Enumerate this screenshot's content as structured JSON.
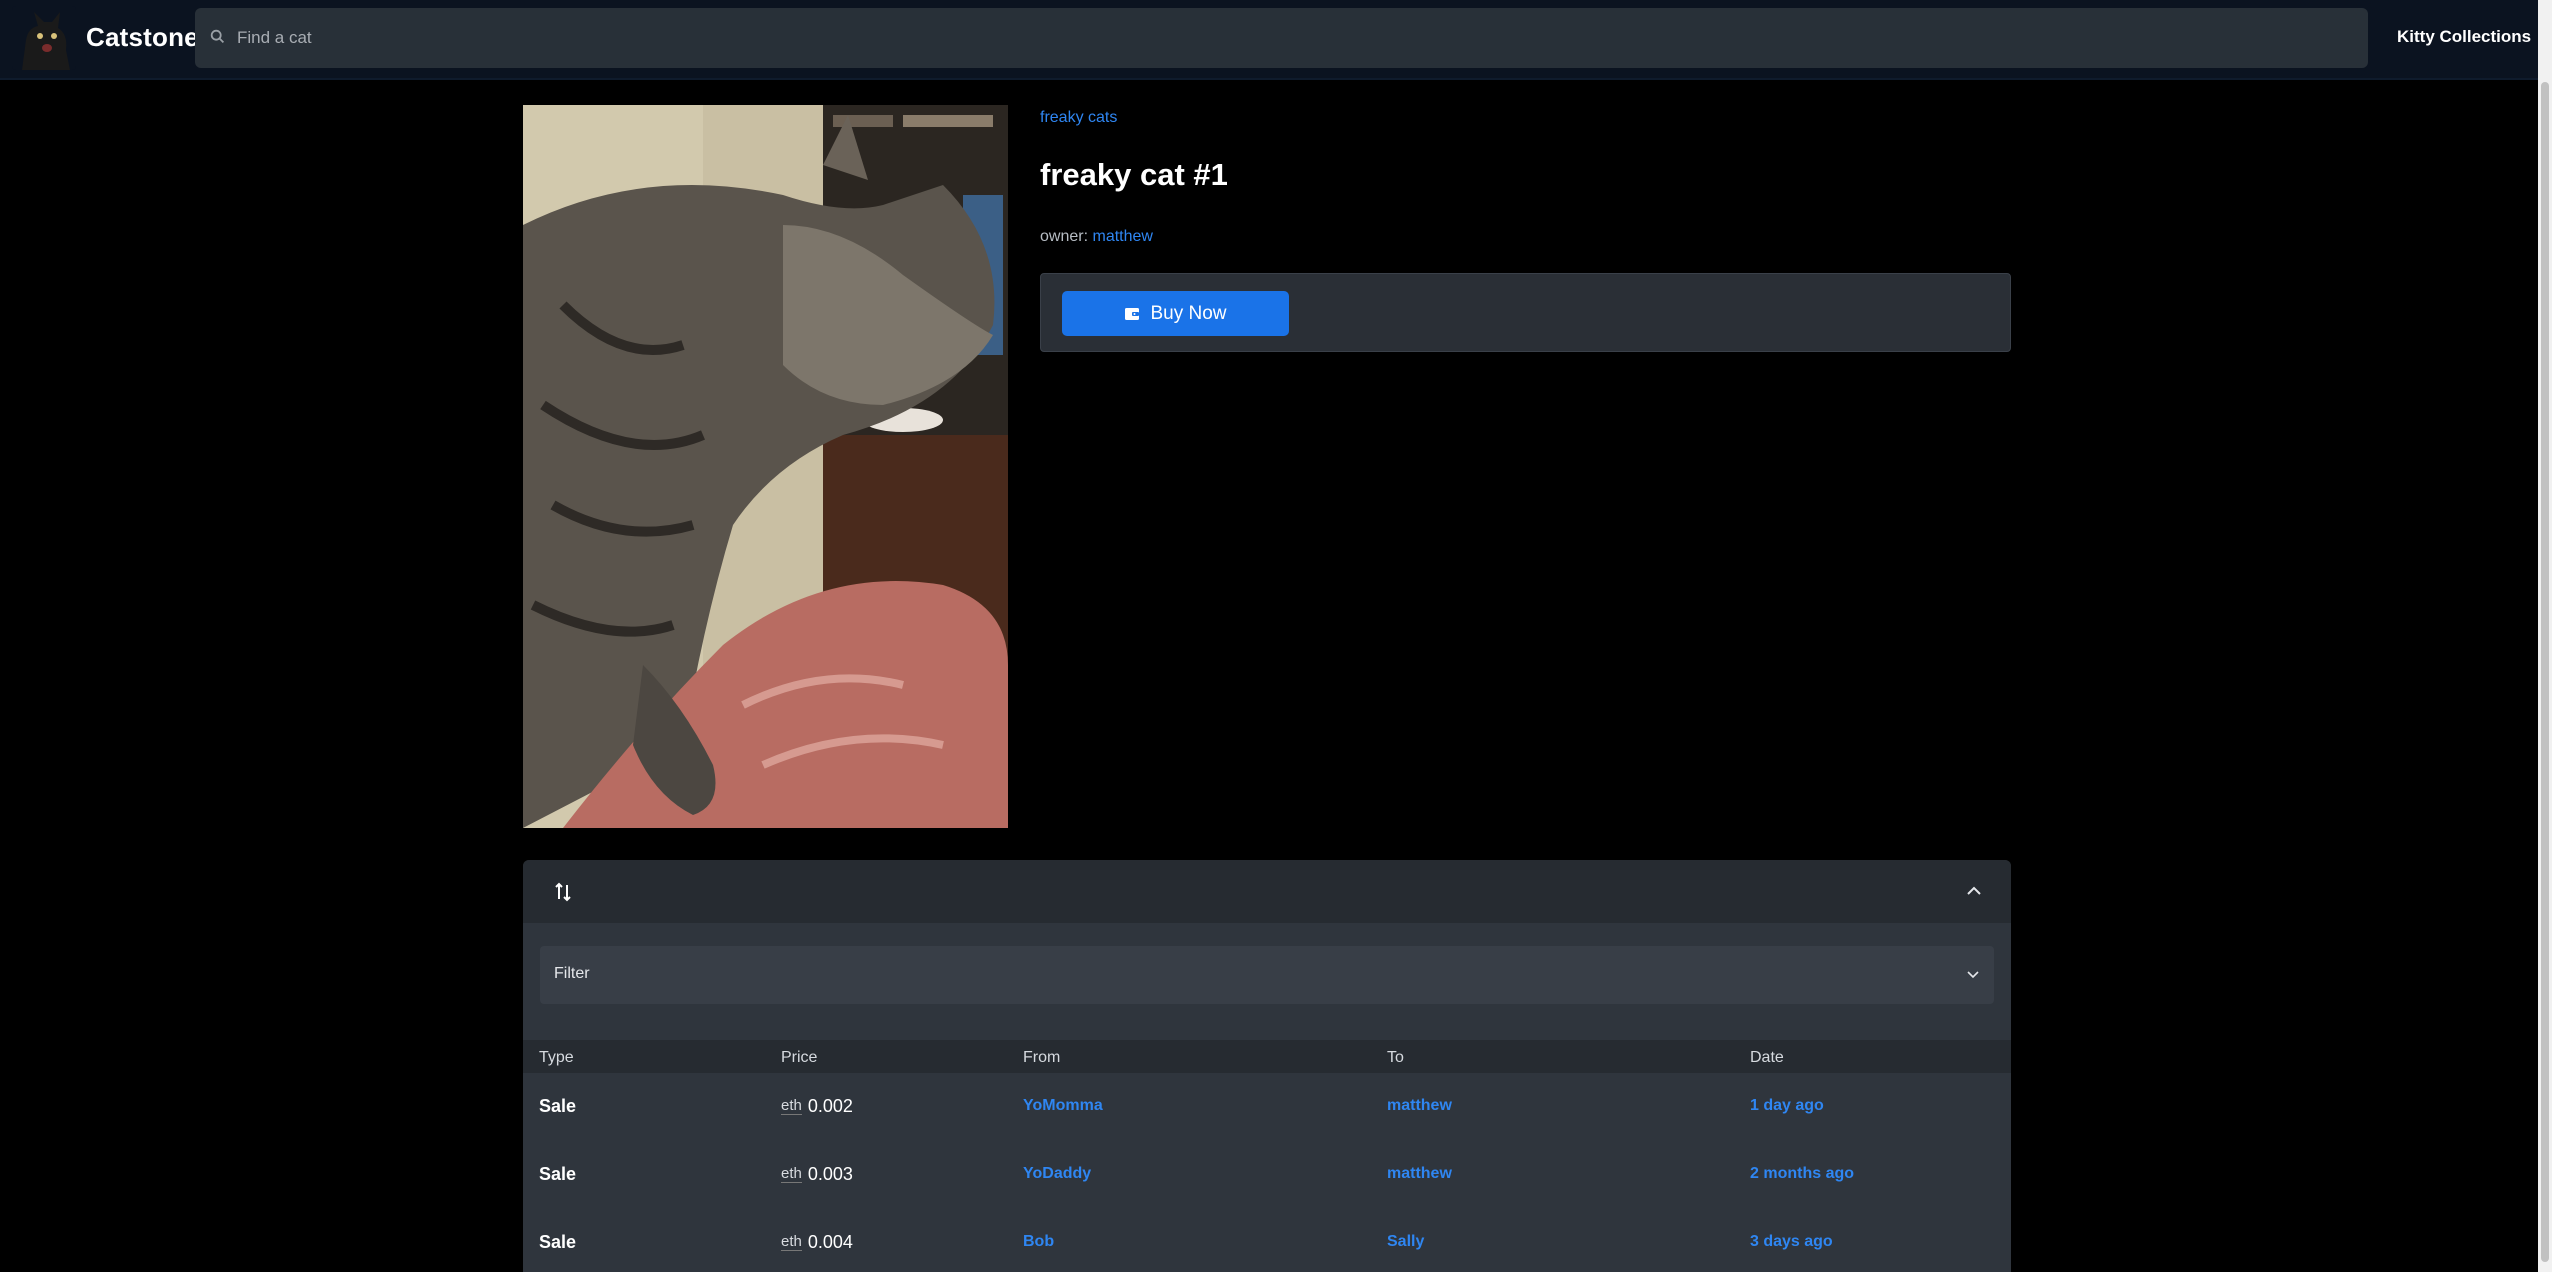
{
  "nav": {
    "brand": "Catstone",
    "search_placeholder": "Find a cat",
    "collections_link": "Kitty Collections"
  },
  "item": {
    "collection": "freaky cats",
    "title": "freaky cat #1",
    "owner_label": "owner:",
    "owner_name": "matthew",
    "buy_label": "Buy Now"
  },
  "activity": {
    "filter_label": "Filter",
    "columns": [
      "Type",
      "Price",
      "From",
      "To",
      "Date"
    ],
    "rows": [
      {
        "type": "Sale",
        "currency_alt": "eth",
        "price": "0.002",
        "from": "YoMomma",
        "to": "matthew",
        "date": "1 day ago"
      },
      {
        "type": "Sale",
        "currency_alt": "eth",
        "price": "0.003",
        "from": "YoDaddy",
        "to": "matthew",
        "date": "2 months ago"
      },
      {
        "type": "Sale",
        "currency_alt": "eth",
        "price": "0.004",
        "from": "Bob",
        "to": "Sally",
        "date": "3 days ago"
      }
    ]
  },
  "colors": {
    "navbar_bg": "#0b1320",
    "accent": "#1a73e8",
    "link": "#2f86f2",
    "panel": "#2a2f36"
  }
}
